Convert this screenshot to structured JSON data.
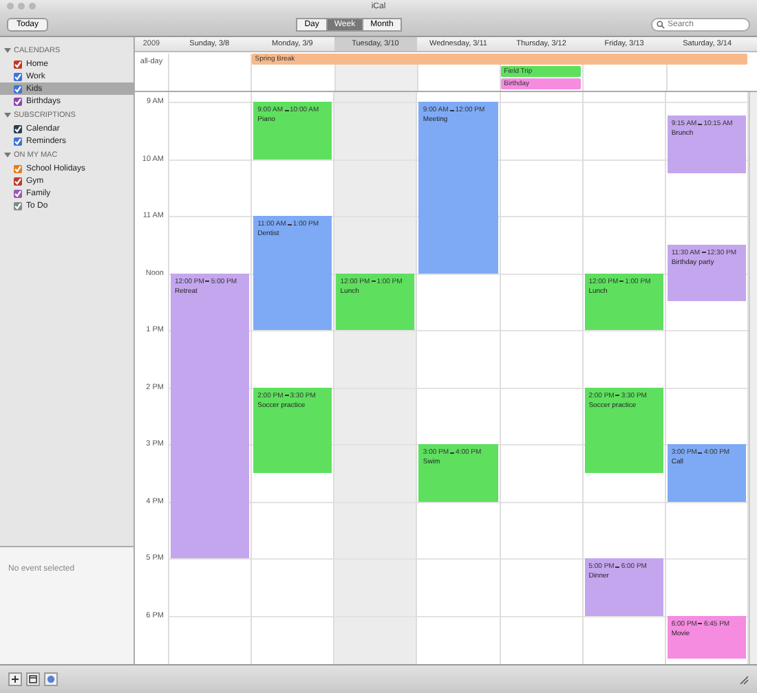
{
  "window": {
    "title": "iCal"
  },
  "toolbar": {
    "today_button": "Today",
    "views": [
      {
        "label": "Day",
        "selected": false
      },
      {
        "label": "Week",
        "selected": true
      },
      {
        "label": "Month",
        "selected": false
      }
    ],
    "search": {
      "placeholder": "Search"
    }
  },
  "sidebar": {
    "groups": [
      {
        "title": "CALENDARS",
        "expanded": true,
        "items": [
          {
            "label": "Home",
            "checked": true,
            "color": "#c0392b",
            "selected": false
          },
          {
            "label": "Work",
            "checked": true,
            "color": "#3b73d9",
            "selected": false
          },
          {
            "label": "Kids",
            "checked": true,
            "color": "#3b73d9",
            "selected": true
          },
          {
            "label": "Birthdays",
            "checked": true,
            "color": "#8e44ad",
            "selected": false
          }
        ]
      },
      {
        "title": "SUBSCRIPTIONS",
        "expanded": true,
        "items": [
          {
            "label": "Calendar",
            "checked": true,
            "color": "#2c3e50",
            "selected": false
          },
          {
            "label": "Reminders",
            "checked": true,
            "color": "#3b73d9",
            "selected": false
          }
        ]
      },
      {
        "title": "ON MY MAC",
        "expanded": true,
        "items": [
          {
            "label": "School Holidays",
            "checked": true,
            "color": "#e67e22",
            "selected": false
          },
          {
            "label": "Gym",
            "checked": true,
            "color": "#c0392b",
            "selected": false
          },
          {
            "label": "Family",
            "checked": true,
            "color": "#9b59b6",
            "selected": false
          },
          {
            "label": "To Do",
            "checked": true,
            "color": "#7f8c8d",
            "selected": false
          }
        ]
      }
    ],
    "detail": {
      "text": "No event selected"
    }
  },
  "calendar": {
    "corner": "2009",
    "all_day_label": "all-day",
    "days": [
      {
        "label": "Sunday, 3/8",
        "today": false,
        "events": [
          {
            "start": "12:00 PM",
            "end": "5:00 PM",
            "title": "Retreat",
            "color": "#c4a6ee"
          }
        ]
      },
      {
        "label": "Monday, 3/9",
        "today": false,
        "events": [
          {
            "start": "9:00 AM",
            "end": "10:00 AM",
            "title": "Piano",
            "color": "#5ee05e"
          },
          {
            "start": "11:00 AM",
            "end": "1:00 PM",
            "title": "Dentist",
            "color": "#7eaaf5"
          },
          {
            "start": "2:00 PM",
            "end": "3:30 PM",
            "title": "Soccer practice",
            "color": "#5ee05e"
          }
        ]
      },
      {
        "label": "Tuesday, 3/10",
        "today": true,
        "events": [
          {
            "start": "12:00 PM",
            "end": "1:00 PM",
            "title": "Lunch",
            "color": "#5ee05e"
          }
        ]
      },
      {
        "label": "Wednesday, 3/11",
        "today": false,
        "events": [
          {
            "start": "9:00 AM",
            "end": "12:00 PM",
            "title": "Meeting",
            "color": "#7eaaf5"
          },
          {
            "start": "3:00 PM",
            "end": "4:00 PM",
            "title": "Swim",
            "color": "#5ee05e"
          }
        ]
      },
      {
        "label": "Thursday, 3/12",
        "today": false
      },
      {
        "label": "Friday, 3/13",
        "today": false,
        "events": [
          {
            "start": "12:00 PM",
            "end": "1:00 PM",
            "title": "Lunch",
            "color": "#5ee05e"
          },
          {
            "start": "2:00 PM",
            "end": "3:30 PM",
            "title": "Soccer practice",
            "color": "#5ee05e"
          },
          {
            "start": "5:00 PM",
            "end": "6:00 PM",
            "title": "Dinner",
            "color": "#c4a6ee"
          }
        ]
      },
      {
        "label": "Saturday, 3/14",
        "today": false,
        "events": [
          {
            "start": "9:15 AM",
            "end": "10:15 AM",
            "title": "Brunch",
            "color": "#c4a6ee"
          },
          {
            "start": "11:30 AM",
            "end": "12:30 PM",
            "title": "Birthday party",
            "color": "#c4a6ee"
          },
          {
            "start": "3:00 PM",
            "end": "4:00 PM",
            "title": "Call",
            "color": "#7eaaf5"
          },
          {
            "start": "6:00 PM",
            "end": "6:45 PM",
            "title": "Movie",
            "color": "#f58ce0"
          }
        ]
      }
    ],
    "all_day_lanes": [
      [
        {
          "kind": "gap"
        },
        {
          "kind": "event",
          "title": "Spring Break",
          "color": "#f7b98a"
        },
        {
          "kind": "continued"
        },
        {
          "kind": "continued"
        },
        {
          "kind": "continued"
        },
        {
          "kind": "continued"
        },
        {
          "kind": "continued"
        }
      ],
      [
        {
          "kind": "gap"
        },
        {
          "kind": "gap"
        },
        {
          "kind": "gap"
        },
        {
          "kind": "gap"
        },
        {
          "kind": "event",
          "title": "Field Trip",
          "color": "#5ee05e"
        }
      ],
      [
        {
          "kind": "gap"
        },
        {
          "kind": "gap"
        },
        {
          "kind": "gap"
        },
        {
          "kind": "gap"
        },
        {
          "kind": "event",
          "title": "Birthday",
          "color": "#f58ce0"
        }
      ]
    ],
    "hours": [
      "9 AM",
      "10 AM",
      "11 AM",
      "Noon",
      "1 PM",
      "2 PM",
      "3 PM",
      "4 PM",
      "5 PM",
      "6 PM"
    ]
  }
}
